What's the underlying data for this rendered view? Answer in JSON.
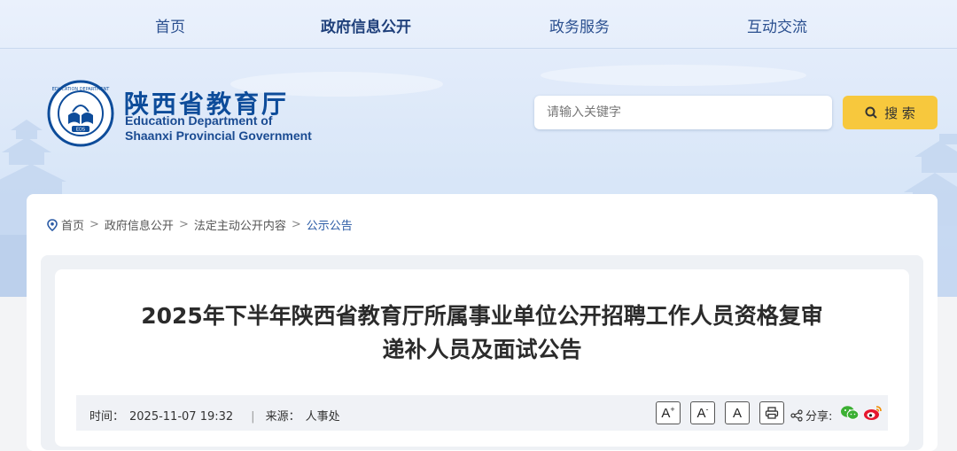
{
  "nav": {
    "items": [
      {
        "label": "首页"
      },
      {
        "label": "政府信息公开"
      },
      {
        "label": "政务服务"
      },
      {
        "label": "互动交流"
      }
    ]
  },
  "header": {
    "site_name_cn": "陕西省教育厅",
    "site_name_en_line1": "Education Department of",
    "site_name_en_line2": "Shaanxi Provincial Government"
  },
  "search": {
    "placeholder": "请输入关键字",
    "button_label": "搜 索"
  },
  "breadcrumb": {
    "items": [
      "首页",
      "政府信息公开",
      "法定主动公开内容",
      "公示公告"
    ]
  },
  "article": {
    "title_line1": "2025年下半年陕西省教育厅所属事业单位公开招聘工作人员资格复审",
    "title_line2": "递补人员及面试公告",
    "time_label": "时间：",
    "time_value": "2025-11-07 19:32",
    "source_label": "来源：",
    "source_value": "人事处",
    "share_label": "分享:"
  },
  "colors": {
    "nav_text": "#2a4f8f",
    "brand_blue": "#0d4c9a",
    "search_button": "#f7c83d",
    "wechat_green": "#3cb034",
    "weibo_red": "#e6162d"
  }
}
